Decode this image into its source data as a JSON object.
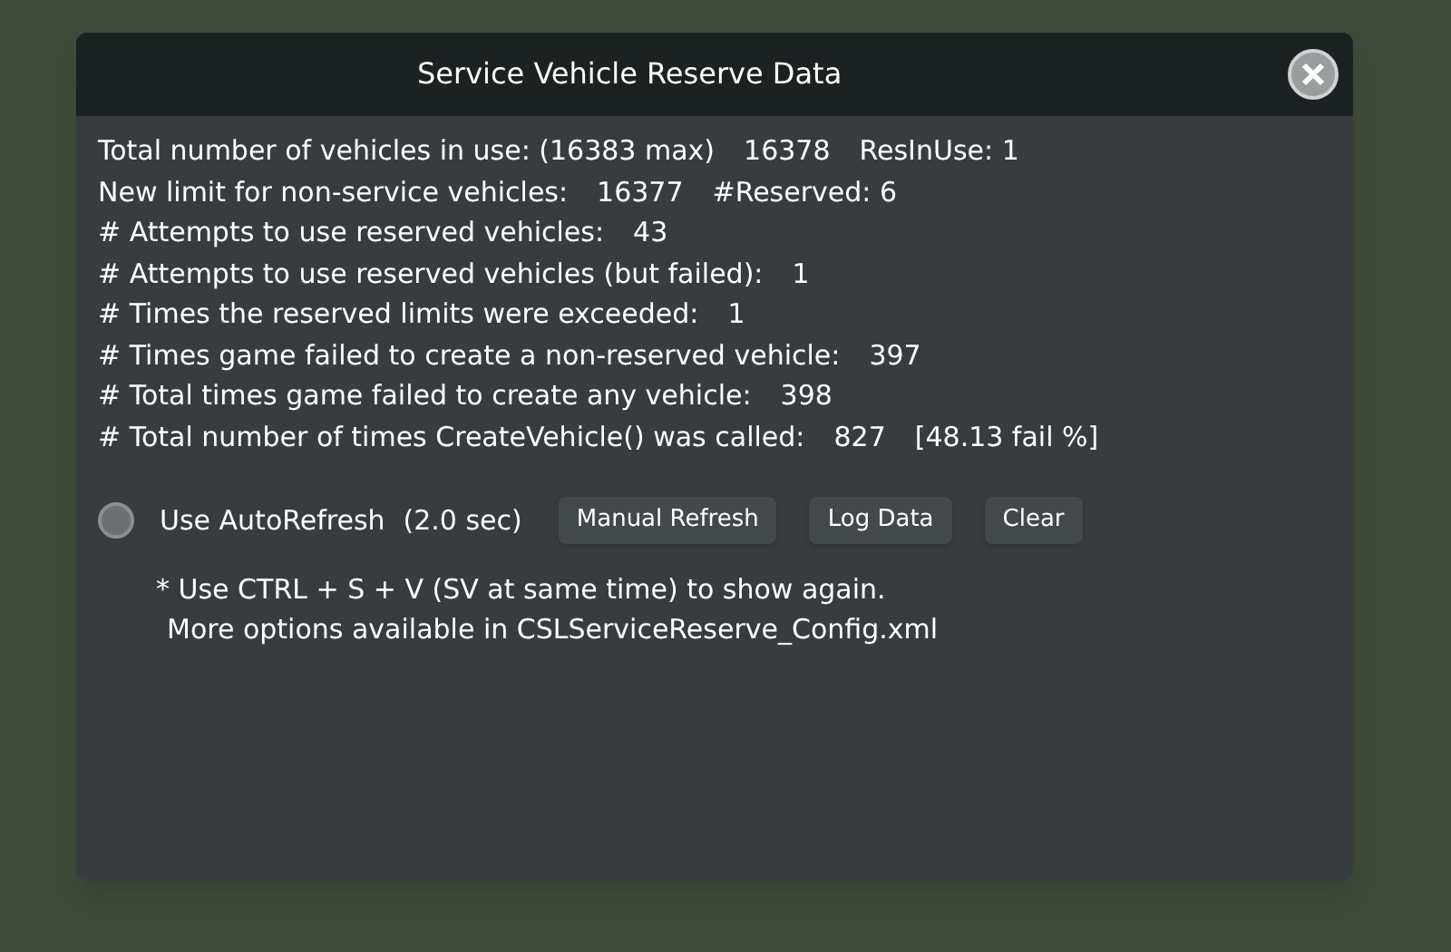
{
  "window": {
    "title": "Service Vehicle Reserve Data"
  },
  "stats": [
    {
      "parts": [
        "Total number of vehicles in use: (16383 max)",
        "16378",
        "ResInUse: 1"
      ]
    },
    {
      "parts": [
        "New limit for non-service vehicles:",
        "16377",
        "#Reserved: 6"
      ]
    },
    {
      "parts": [
        "# Attempts to use reserved vehicles:",
        "43"
      ]
    },
    {
      "parts": [
        "# Attempts to use reserved vehicles (but failed):",
        "1"
      ]
    },
    {
      "parts": [
        "# Times the reserved limits were exceeded:",
        "1"
      ]
    },
    {
      "parts": [
        "# Times game failed to create a non-reserved vehicle:",
        "397"
      ]
    },
    {
      "parts": [
        "# Total times game failed to create any vehicle:",
        "398"
      ]
    },
    {
      "parts": [
        "# Total number of times CreateVehicle() was called:",
        "827",
        "[48.13 fail %]"
      ]
    }
  ],
  "autorefresh": {
    "label": "Use AutoRefresh",
    "interval": "(2.0 sec)",
    "checked": false
  },
  "buttons": [
    "Manual Refresh",
    "Log Data",
    "Clear"
  ],
  "notes": [
    "* Use CTRL + S + V (SV at same time) to show again.",
    "More options available in CSLServiceReserve_Config.xml"
  ]
}
